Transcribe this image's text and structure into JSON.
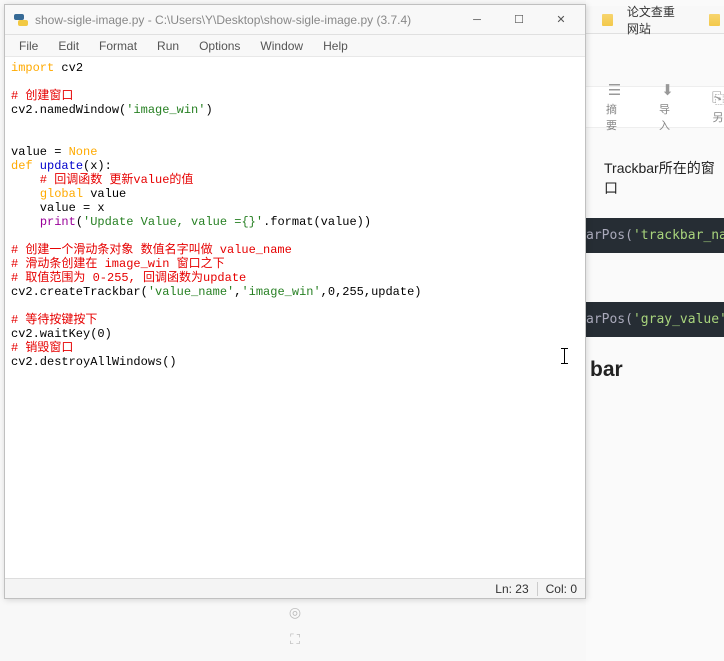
{
  "window": {
    "title": "show-sigle-image.py - C:\\Users\\Y\\Desktop\\show-sigle-image.py (3.7.4)"
  },
  "menu": {
    "file": "File",
    "edit": "Edit",
    "format": "Format",
    "run": "Run",
    "options": "Options",
    "window": "Window",
    "help": "Help"
  },
  "status": {
    "ln": "Ln: 23",
    "col": "Col: 0"
  },
  "code": {
    "l1_kw": "import",
    "l1_mod": " cv2",
    "l3": "# 创建窗口",
    "l4a": "cv2.namedWindow(",
    "l4b": "'image_win'",
    "l4c": ")",
    "l7a": "value = ",
    "l7b": "None",
    "l8a": "def",
    "l8b": " update",
    "l8c": "(x):",
    "l9": "    # 回调函数 更新value的值",
    "l10a": "    ",
    "l10b": "global",
    "l10c": " value",
    "l11": "    value = x",
    "l12a": "    ",
    "l12b": "print",
    "l12c": "(",
    "l12d": "'Update Value, value ={}'",
    "l12e": ".format(value))",
    "l14": "# 创建一个滑动条对象 数值名字叫做 value_name",
    "l15": "# 滑动条创建在 image_win 窗口之下",
    "l16": "# 取值范围为 0-255, 回调函数为update",
    "l17a": "cv2.createTrackbar(",
    "l17b": "'value_name'",
    "l17c": ",",
    "l17d": "'image_win'",
    "l17e": ",0,255,update)",
    "l19": "# 等待按键按下",
    "l20": "cv2.waitKey(0)",
    "l21": "# 销毁窗口",
    "l22": "cv2.destroyAllWindows()"
  },
  "bg": {
    "bookmark": "论文查重网站",
    "tb_summary": "摘要",
    "tb_import": "导入",
    "tb_save": "另",
    "body": "Trackbar所在的窗口",
    "snippet1_a": "arPos(",
    "snippet1_b": "'trackbar_name",
    "snippet2_a": "arPos(",
    "snippet2_b": "'gray_value'",
    "snippet2_c": ",",
    "heading": "bar"
  }
}
